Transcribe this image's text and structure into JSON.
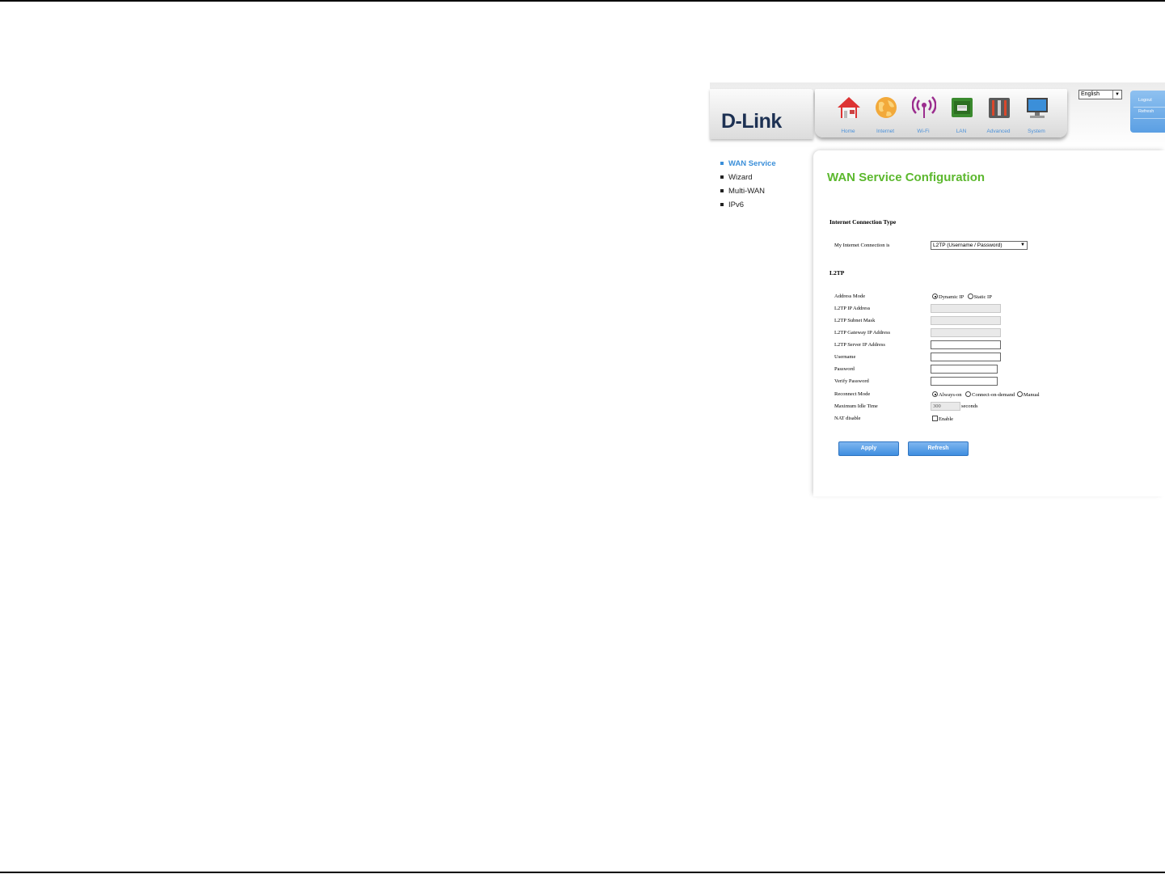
{
  "header": {
    "logo": "D-Link",
    "nav": [
      {
        "label": "Home",
        "icon": "home-icon"
      },
      {
        "label": "Internet",
        "icon": "globe-icon",
        "active": true
      },
      {
        "label": "Wi-Fi",
        "icon": "wifi-icon"
      },
      {
        "label": "LAN",
        "icon": "lan-icon"
      },
      {
        "label": "Advanced",
        "icon": "tools-icon"
      },
      {
        "label": "System",
        "icon": "monitor-icon"
      }
    ],
    "language": "English",
    "logout_label": "Logout",
    "refresh_label": "Refresh"
  },
  "menu": {
    "items": [
      {
        "label": "WAN Service",
        "active": true
      },
      {
        "label": "Wizard"
      },
      {
        "label": "Multi-WAN"
      },
      {
        "label": "IPv6"
      }
    ]
  },
  "content": {
    "title": "WAN Service Configuration",
    "section1_title": "Internet Connection Type",
    "connection_label": "My Internet Connection is",
    "connection_value": "L2TP (Username / Password)",
    "section2_title": "L2TP",
    "address_mode_label": "Address Mode",
    "address_mode_options": [
      "Dynamic IP",
      "Static IP"
    ],
    "ip_address_label": "L2TP IP Address",
    "subnet_mask_label": "L2TP Subnet Mask",
    "gateway_label": "L2TP Gateway IP Address",
    "server_label": "L2TP Server IP Address",
    "username_label": "Username",
    "password_label": "Password",
    "verify_password_label": "Verify Password",
    "reconnect_label": "Reconnect Mode",
    "reconnect_options": [
      "Always-on",
      "Connect-on-demand",
      "Manual"
    ],
    "idle_label": "Maximum Idle Time",
    "idle_value": "300",
    "idle_unit": "seconds",
    "nat_label": "NAT disable",
    "nat_option": "Enable",
    "apply_label": "Apply",
    "refresh_label": "Refresh"
  },
  "colors": {
    "title_green": "#5cb82e",
    "link_blue": "#3b8fd9",
    "button_blue": "#3f8ee0"
  }
}
